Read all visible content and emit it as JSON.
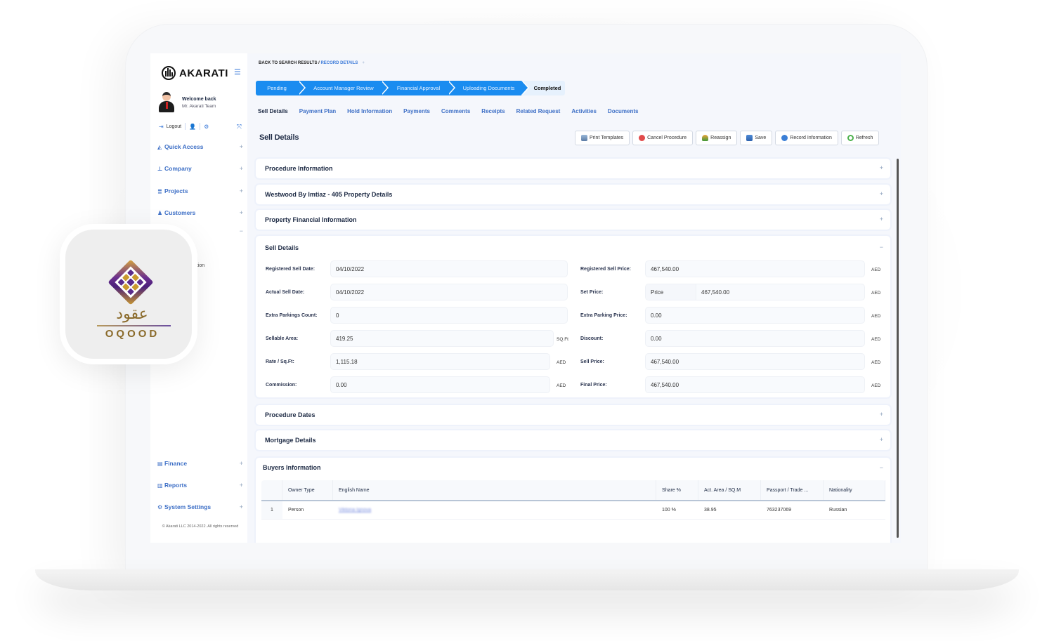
{
  "brand": {
    "name": "AKARATI"
  },
  "user": {
    "welcome": "Welcome back",
    "name": "Mr. Akarati Team",
    "logout_label": "Logout"
  },
  "sidebar": {
    "items": [
      {
        "label": "Quick Access",
        "icon": "quick-access-icon",
        "toggle": "+"
      },
      {
        "label": "Company",
        "icon": "sitemap-icon",
        "toggle": "+"
      },
      {
        "label": "Projects",
        "icon": "list-icon",
        "toggle": "+"
      },
      {
        "label": "Customers",
        "icon": "user-icon",
        "toggle": "+"
      },
      {
        "label": "",
        "icon": "",
        "toggle": "−"
      },
      {
        "label": "Finance",
        "icon": "document-icon",
        "toggle": "+"
      },
      {
        "label": "Reports",
        "icon": "report-icon",
        "toggle": "+"
      },
      {
        "label": "System Settings",
        "icon": "gears-icon",
        "toggle": "+"
      }
    ],
    "partial_sub_items": [
      "ation",
      "l"
    ],
    "copyright": "© Akarati LLC 2014-2022. All rights reserved"
  },
  "breadcrumb": {
    "back": "BACK TO SEARCH RESULTS",
    "separator": " / ",
    "current": "RECORD DETAILS",
    "add": "+"
  },
  "stepper": {
    "steps": [
      {
        "label": "Pending",
        "state": "passed"
      },
      {
        "label": "Account Manager Review",
        "state": "passed"
      },
      {
        "label": "Financial Approval",
        "state": "passed"
      },
      {
        "label": "Uploading Documents",
        "state": "passed"
      },
      {
        "label": "Completed",
        "state": "current"
      }
    ]
  },
  "tabs": [
    {
      "label": "Sell Details",
      "active": true
    },
    {
      "label": "Payment Plan"
    },
    {
      "label": "Hold Information"
    },
    {
      "label": "Payments"
    },
    {
      "label": "Comments"
    },
    {
      "label": "Receipts"
    },
    {
      "label": "Related Request"
    },
    {
      "label": "Activities"
    },
    {
      "label": "Documents"
    }
  ],
  "page_title": "Sell Details",
  "toolbar": {
    "print": "Print Templates",
    "cancel": "Cancel Procedure",
    "reassign": "Reassign",
    "save": "Save",
    "record_info": "Record Information",
    "refresh": "Refresh"
  },
  "panels": {
    "procedure_info": {
      "title": "Procedure Information",
      "toggle": "+"
    },
    "property_details": {
      "title": "Westwood By Imtiaz - 405 Property Details",
      "toggle": "+"
    },
    "financial_info": {
      "title": "Property Financial Information",
      "toggle": "+"
    },
    "sell_details": {
      "title": "Sell Details",
      "toggle": "−"
    },
    "procedure_dates": {
      "title": "Procedure Dates",
      "toggle": "+"
    },
    "mortgage": {
      "title": "Mortgage Details",
      "toggle": "+"
    },
    "buyers": {
      "title": "Buyers Information",
      "toggle": "−"
    }
  },
  "sell_details": {
    "left": [
      {
        "label": "Registered Sell Date:",
        "value": "04/10/2022",
        "unit": ""
      },
      {
        "label": "Actual Sell Date:",
        "value": "04/10/2022",
        "unit": ""
      },
      {
        "label": "Extra Parkings Count:",
        "value": "0",
        "unit": ""
      },
      {
        "label": "Sellable Area:",
        "value": "419.25",
        "unit": "SQ.Ft"
      },
      {
        "label": "Rate / Sq.Ft:",
        "value": "1,115.18",
        "unit": "AED"
      },
      {
        "label": "Commission:",
        "value": "0.00",
        "unit": "AED"
      }
    ],
    "right": [
      {
        "label": "Registered Sell Price:",
        "value": "467,540.00",
        "unit": "AED"
      },
      {
        "label": "Set Price:",
        "prefix": "Price",
        "value": "467,540.00",
        "unit": "AED"
      },
      {
        "label": "Extra Parking Price:",
        "value": "0.00",
        "unit": "AED"
      },
      {
        "label": "Discount:",
        "value": "0.00",
        "unit": "AED"
      },
      {
        "label": "Sell Price:",
        "value": "467,540.00",
        "unit": "AED"
      },
      {
        "label": "Final Price:",
        "value": "467,540.00",
        "unit": "AED"
      }
    ]
  },
  "buyers": {
    "columns": [
      "",
      "Owner Type",
      "English Name",
      "Share %",
      "Act. Area / SQ.M",
      "Passport / Trade ...",
      "Nationality"
    ],
    "rows": [
      {
        "index": "1",
        "owner_type": "Person",
        "english_name": "Viktoria Ignova",
        "share": "100 %",
        "area": "38.95",
        "passport": "763237069",
        "nationality": "Russian"
      }
    ]
  },
  "badge": {
    "arabic": "عقود",
    "latin": "OQOOD"
  },
  "colors": {
    "accent": "#1a8cf0",
    "nav": "#3d6fc6",
    "text": "#1d2a44"
  }
}
